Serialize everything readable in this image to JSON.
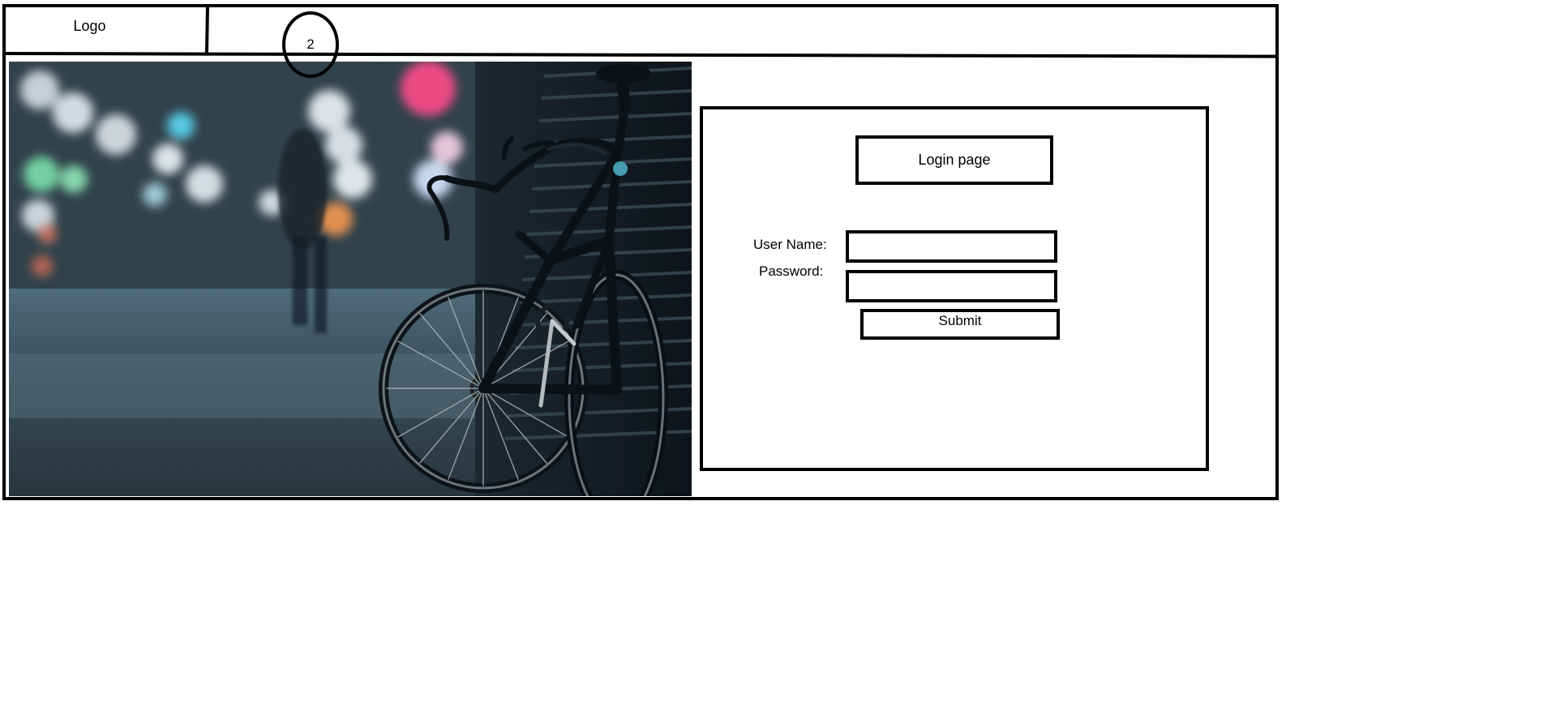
{
  "header": {
    "logo_label": "Logo",
    "nav_badge": "2"
  },
  "hero": {
    "image_description": "blurred night street with bicycle leaning against shutter"
  },
  "login": {
    "title": "Login page",
    "username_label": "User Name:",
    "password_label": "Password:",
    "username_value": "",
    "password_value": "",
    "submit_label": "Submit"
  },
  "colors": {
    "stroke": "#000000",
    "background": "#ffffff"
  }
}
